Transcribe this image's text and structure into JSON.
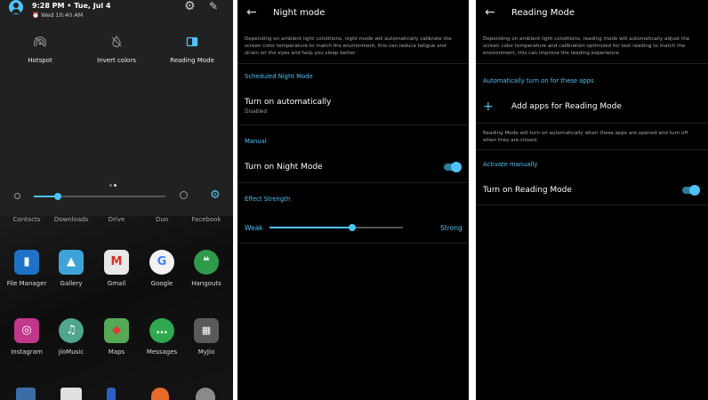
{
  "quick_settings": {
    "status_time": "9:28 PM • Tue, Jul 4",
    "alarm_text": "Wed 10:40 AM",
    "tiles": [
      {
        "label": "Hotspot",
        "icon": "hotspot-icon"
      },
      {
        "label": "Invert colors",
        "icon": "invert-colors-icon"
      },
      {
        "label": "Reading Mode",
        "icon": "reading-mode-icon"
      }
    ],
    "brightness_level": 0.18,
    "accent_color": "#4fc3f7"
  },
  "home_screen": {
    "dock_labels": [
      "Contacts",
      "Downloads",
      "Drive",
      "Duo",
      "Facebook"
    ],
    "apps_row1": [
      {
        "label": "File Manager",
        "color": "#1e73c8",
        "icon": "file-manager-icon",
        "glyph": "▮"
      },
      {
        "label": "Gallery",
        "color": "#3ea3d8",
        "icon": "gallery-icon",
        "glyph": "▲"
      },
      {
        "label": "Gmail",
        "color": "#e8e8e8",
        "icon": "gmail-icon",
        "glyph": "M"
      },
      {
        "label": "Google",
        "color": "#f2f2f2",
        "icon": "google-icon",
        "glyph": "G"
      },
      {
        "label": "Hangouts",
        "color": "#2e9a4c",
        "icon": "hangouts-icon",
        "glyph": "❝"
      }
    ],
    "apps_row2": [
      {
        "label": "Instagram",
        "color": "#c1378c",
        "icon": "instagram-icon",
        "glyph": "◎"
      },
      {
        "label": "JioMusic",
        "color": "#4fa58e",
        "icon": "jiomusic-icon",
        "glyph": "♫"
      },
      {
        "label": "Maps",
        "color": "#55a854",
        "icon": "maps-icon",
        "glyph": "◆"
      },
      {
        "label": "Messages",
        "color": "#2fa84f",
        "icon": "messages-icon",
        "glyph": "…"
      },
      {
        "label": "MyJio",
        "color": "#5a5a5a",
        "icon": "myjio-icon",
        "glyph": "▦"
      }
    ]
  },
  "night_mode": {
    "title": "Night mode",
    "description": "Depending on ambient light conditions, night mode will automatically calibrate the screen color temperature to match the environment, this can reduce fatigue and strain on the eyes and help you sleep better.",
    "scheduled_section": "Scheduled Night Mode",
    "auto_title": "Turn on automatically",
    "auto_sub": "Disabled",
    "manual_section": "Manual",
    "manual_toggle_label": "Turn on Night Mode",
    "manual_toggle_on": true,
    "effect_section": "Effect Strength",
    "weak_label": "Weak",
    "strong_label": "Strong",
    "effect_strength": 0.62
  },
  "reading_mode": {
    "title": "Reading Mode",
    "description": "Depending on ambient light conditions, reading mode will automatically adjust the screen color temperature and calibration optimized for text reading to match the environment, this can improve the reading experience.",
    "auto_section": "Automatically turn on for these apps",
    "add_apps_label": "Add apps for Reading Mode",
    "apps_note": "Reading Mode will turn on automatically when these apps are opened and turn off when they are closed.",
    "manual_section": "Activate manually",
    "manual_toggle_label": "Turn on Reading Mode",
    "manual_toggle_on": true
  }
}
